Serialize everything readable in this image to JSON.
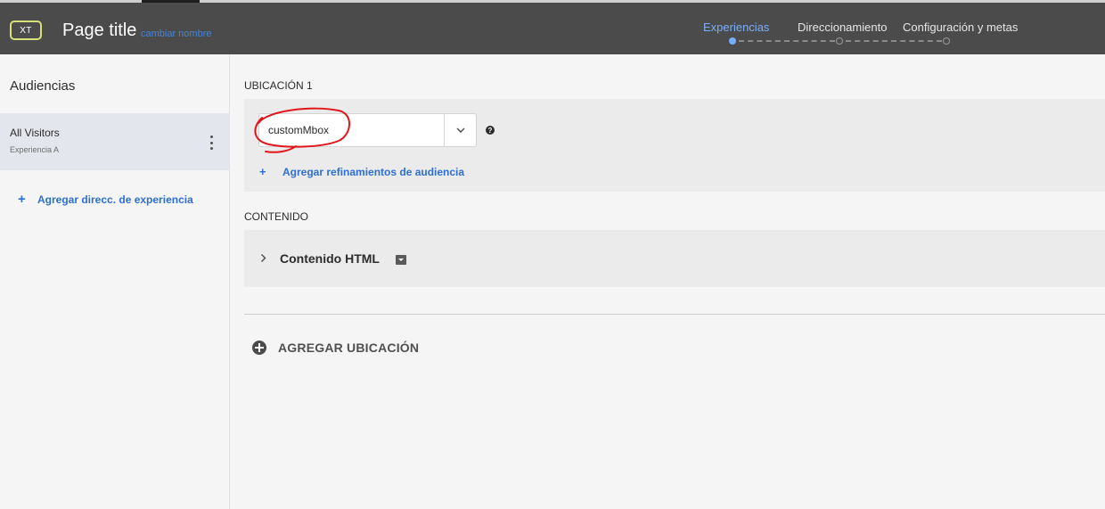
{
  "header": {
    "badge": "XT",
    "title": "Page title",
    "rename_link": "cambiar nombre",
    "steps": [
      {
        "label": "Experiencias",
        "active": true
      },
      {
        "label": "Direccionamiento",
        "active": false
      },
      {
        "label": "Configuración y metas",
        "active": false
      }
    ]
  },
  "sidebar": {
    "heading": "Audiencias",
    "audiences": [
      {
        "name": "All Visitors",
        "experience": "Experiencia A"
      }
    ],
    "add_experience_label": "Agregar direcc. de experiencia"
  },
  "main": {
    "location_label": "UBICACIÓN 1",
    "location_value": "customMbox",
    "add_refinements_label": "Agregar refinamientos de audiencia",
    "content_label": "CONTENIDO",
    "content_item": "Contenido HTML",
    "add_location_label": "AGREGAR UBICACIÓN"
  },
  "colors": {
    "header_bg": "#4b4b4b",
    "accent": "#2d6fd3",
    "active_step": "#78aefc",
    "annotation_red": "#e0161b"
  }
}
